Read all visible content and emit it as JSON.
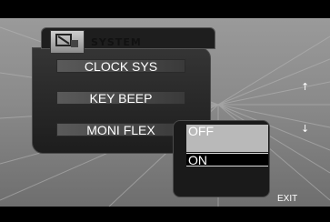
{
  "header": {
    "title": "SYSTEM",
    "icon": "system-icon"
  },
  "menu": {
    "items": [
      {
        "label": "CLOCK SYS"
      },
      {
        "label": "KEY BEEP"
      },
      {
        "label": "MONI FLEX"
      }
    ]
  },
  "submenu": {
    "options": [
      {
        "label": "OFF"
      },
      {
        "label": "ON"
      }
    ],
    "selected": "ON"
  },
  "nav": {
    "up_icon": "arrow-up-icon",
    "down_icon": "arrow-down-icon",
    "exit_label": "EXIT"
  },
  "colors": {
    "background": "#8a8a8a",
    "menu_frame": "#1d1d1d",
    "highlight": "#b9b9b9",
    "text": "#ffffff"
  }
}
